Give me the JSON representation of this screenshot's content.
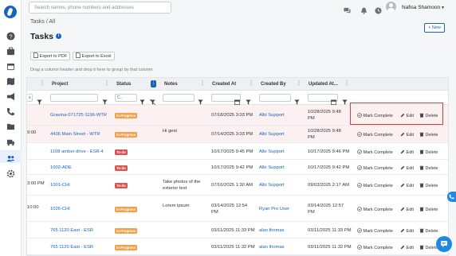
{
  "header": {
    "search_placeholder": "Search names, phone numbers and addresses",
    "user_name": "Nafisa Shamoon"
  },
  "breadcrumb": "Tasks / All",
  "page_title": "Tasks",
  "new_button": "+ New",
  "export_pdf": "Export to PDF",
  "export_excel": "Export to Excel",
  "group_hint": "Drag a column header and drop it here to group by that column",
  "columns": {
    "project": "Project",
    "status": "Status",
    "notes": "Notes",
    "created_at": "Created At",
    "created_by": "Created By",
    "updated_at": "Updated At..."
  },
  "filters": {
    "status": "C..",
    "partial_left": "s"
  },
  "actions": {
    "complete": "Mark Complete",
    "edit": "Edit",
    "delete": "Delete"
  },
  "rows": [
    {
      "time_fragment": "",
      "project": "Gravina-071725-1196-WTR",
      "status": "In Progress",
      "notes": "",
      "notes2": "",
      "created_at": "07/18/2025 3:03 PM",
      "created_by": "Albi Support",
      "updated_at": "10/28/2025 9:48",
      "updated_at2": "PM"
    },
    {
      "time_fragment": "9:00",
      "project": "4436 Main Street - WTR",
      "status": "In Progress",
      "notes": "Hi gest",
      "notes2": "",
      "created_at": "07/14/2025 3:03 PM",
      "created_by": "Albi Support",
      "updated_at": "10/28/2025 9:48",
      "updated_at2": "PM"
    },
    {
      "time_fragment": "",
      "project": "1108 amber drive - ESR 4",
      "status": "To-do",
      "notes": "",
      "notes2": "",
      "created_at": "10/17/2025 9:45 PM",
      "created_by": "Albi Support",
      "updated_at": "10/17/2025 9:46 PM",
      "updated_at2": ""
    },
    {
      "time_fragment": "",
      "project": "1002-ADE",
      "status": "To-do",
      "notes": "",
      "notes2": "",
      "created_at": "10/17/2025 9:42 PM",
      "created_by": "Albi Support",
      "updated_at": "10/17/2025 9:42 PM",
      "updated_at2": ""
    },
    {
      "time_fragment": "3:00 PM",
      "project": "1001-CHI",
      "status": "To-do",
      "notes": "Take photos of the",
      "notes2": "exterior test",
      "created_at": "07/16/2025 1:30 AM",
      "created_by": "Albi Support",
      "updated_at": "09/03/2025 2:17 AM",
      "updated_at2": ""
    },
    {
      "time_fragment": "10:00",
      "project": "1026-CHI",
      "status": "In Progress",
      "notes": "Lorem ipsum",
      "notes2": "",
      "created_at": "03/14/2025 12:54",
      "created_at2": "PM",
      "created_by": "Ryan Pro User",
      "updated_at": "03/14/2025 12:57",
      "updated_at2": "PM"
    },
    {
      "time_fragment": "",
      "project": "765 1120 East - ESR",
      "status": "In Progress",
      "notes": "",
      "notes2": "",
      "created_at": "03/11/2025 11:33 PM",
      "created_by": "alan thomas",
      "updated_at": "03/11/2025 11:33 PM",
      "updated_at2": ""
    },
    {
      "time_fragment": "",
      "project": "765 1120 East - ESR",
      "status": "In Progress",
      "notes": "",
      "notes2": "",
      "created_at": "03/11/2025 11:32 PM",
      "created_by": "alan thomas",
      "updated_at": "03/11/2025 11:32 PM",
      "updated_at2": ""
    }
  ],
  "colors": {
    "accent": "#1565c0",
    "in_progress": "#f0a14a",
    "todo": "#d9534f",
    "highlight": "#e53935",
    "row_pink": "#fdf0f1"
  },
  "icons": [
    "logo-icon",
    "help-icon",
    "briefcase-icon",
    "calendar-icon",
    "map-icon",
    "megaphone-icon",
    "phone-icon",
    "folder-icon",
    "truck-icon",
    "people-icon",
    "settings-icon",
    "chat-icon",
    "bell-icon",
    "clock-icon",
    "pdf-icon",
    "excel-icon",
    "filter-icon",
    "check-circle-icon",
    "pencil-icon",
    "trash-icon"
  ]
}
